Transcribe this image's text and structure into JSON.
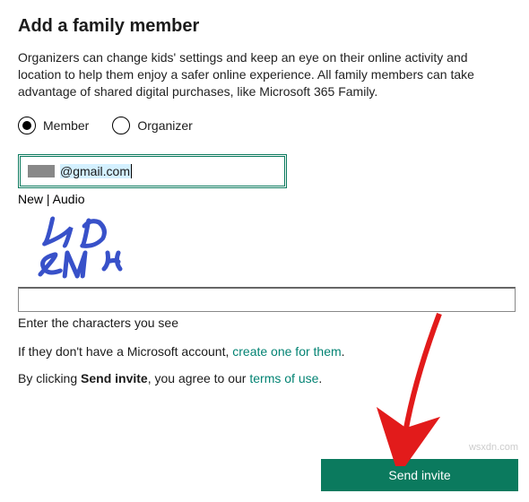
{
  "title": "Add a family member",
  "description": "Organizers can change kids' settings and keep an eye on their online activity and location to help them enjoy a safer online experience. All family members can take advantage of shared digital purchases, like Microsoft 365 Family.",
  "role_options": {
    "member": "Member",
    "organizer": "Organizer",
    "selected": "member"
  },
  "email": {
    "value": "@gmail.com"
  },
  "captcha": {
    "links_new": "New",
    "links_sep": " | ",
    "links_audio": "Audio",
    "text": "PD SMY",
    "input_value": "",
    "hint": "Enter the characters you see"
  },
  "no_account": {
    "prefix": "If they don't have a Microsoft account, ",
    "link": "create one for them",
    "suffix": "."
  },
  "agree": {
    "prefix": "By clicking ",
    "bold": "Send invite",
    "mid": ", you agree to our ",
    "link": "terms of use",
    "suffix": "."
  },
  "send_button": "Send invite",
  "watermark": "wsxdn.com"
}
